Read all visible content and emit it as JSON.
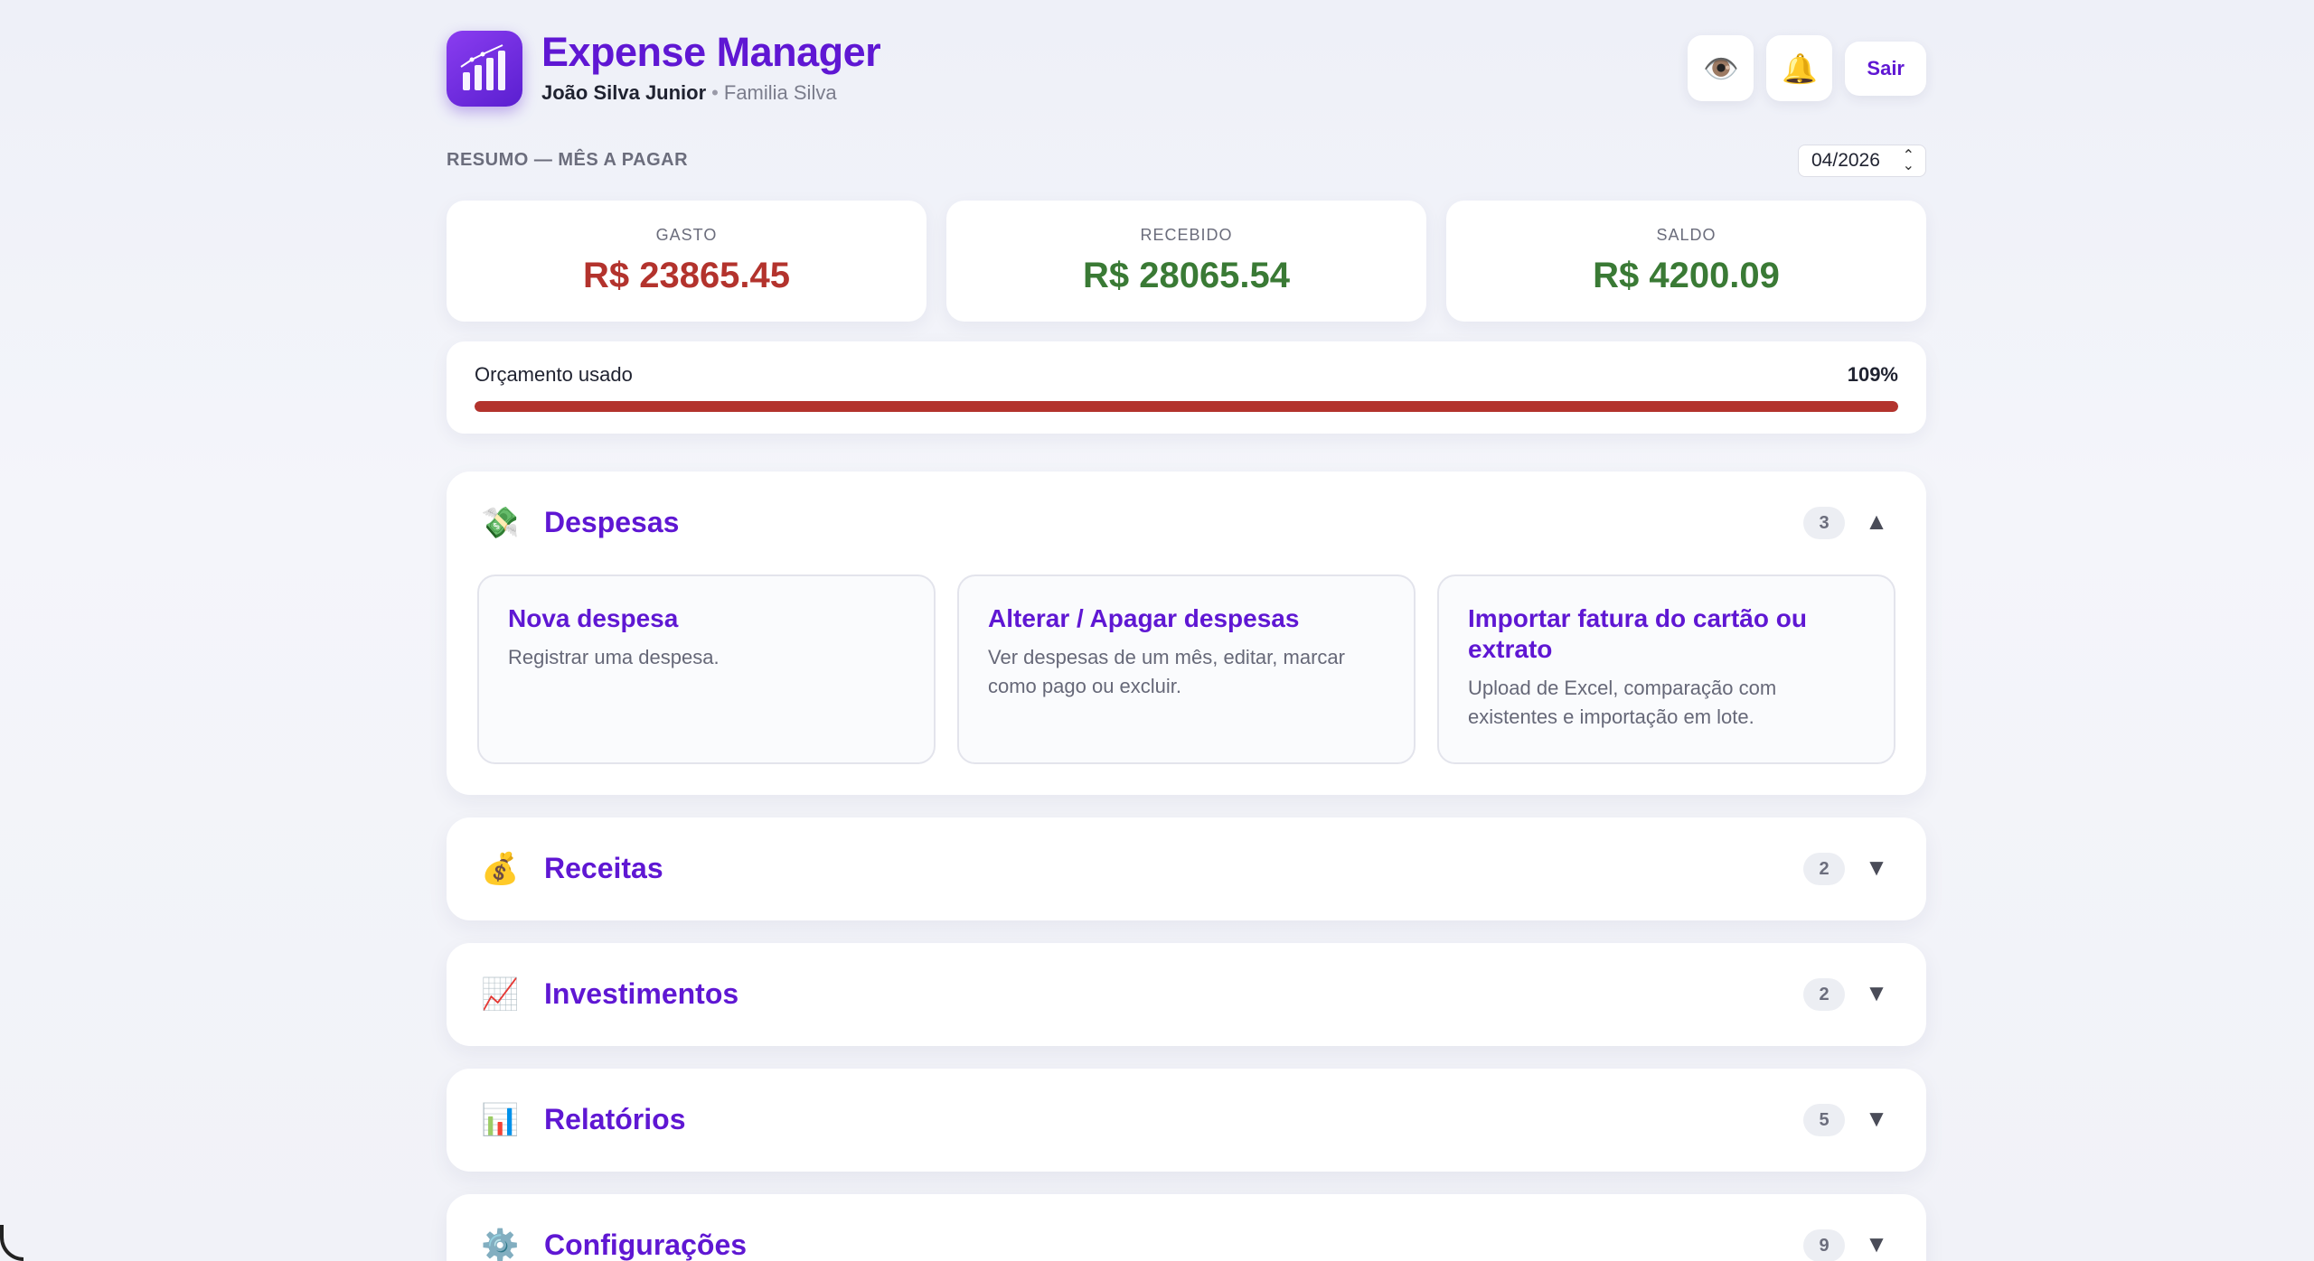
{
  "app": {
    "title": "Expense Manager",
    "user_name": "João Silva Junior",
    "separator": "•",
    "family": "Familia Silva",
    "accent_color": "#5f17d3"
  },
  "header_actions": {
    "visibility_icon": "eye-icon",
    "notifications_icon": "bell-icon",
    "logout_label": "Sair"
  },
  "resumo": {
    "label": "RESUMO — MÊS A PAGAR",
    "month": "04/2026"
  },
  "summary": [
    {
      "label": "GASTO",
      "value": "R$ 23865.45",
      "status": "negative",
      "color": "#b3332d"
    },
    {
      "label": "RECEBIDO",
      "value": "R$ 28065.54",
      "status": "positive",
      "color": "#3a7a35"
    },
    {
      "label": "SALDO",
      "value": "R$ 4200.09",
      "status": "positive",
      "color": "#3a7a35"
    }
  ],
  "budget": {
    "label": "Orçamento usado",
    "percent_label": "109%",
    "percent_value": 109,
    "bar_color": "#b3332d"
  },
  "sections": [
    {
      "title": "Despesas",
      "icon": "money-with-wings-icon",
      "count": "3",
      "expanded": true,
      "chevron": "▲",
      "actions": [
        {
          "title": "Nova despesa",
          "description": "Registrar uma despesa."
        },
        {
          "title": "Alterar / Apagar despesas",
          "description": "Ver despesas de um mês, editar, marcar como pago ou excluir."
        },
        {
          "title": "Importar fatura do cartão ou extrato",
          "description": "Upload de Excel, comparação com existentes e importação em lote."
        }
      ]
    },
    {
      "title": "Receitas",
      "icon": "money-bag-icon",
      "count": "2",
      "expanded": false,
      "chevron": "▼"
    },
    {
      "title": "Investimentos",
      "icon": "chart-increasing-icon",
      "count": "2",
      "expanded": false,
      "chevron": "▼"
    },
    {
      "title": "Relatórios",
      "icon": "bar-chart-icon",
      "count": "5",
      "expanded": false,
      "chevron": "▼"
    },
    {
      "title": "Configurações",
      "icon": "gear-icon",
      "count": "9",
      "expanded": false,
      "chevron": "▼"
    }
  ]
}
